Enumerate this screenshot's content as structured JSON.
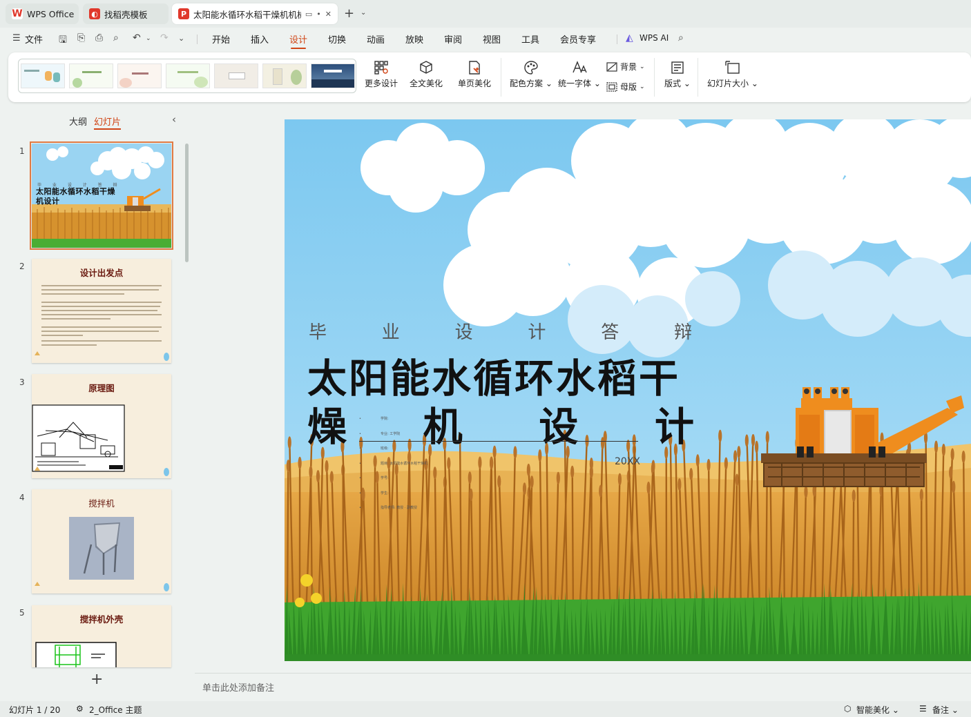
{
  "tabs": [
    {
      "label": "WPS Office",
      "icon": "wps-logo-icon"
    },
    {
      "label": "找稻壳模板",
      "icon": "docer-icon"
    },
    {
      "label": "太阳能水循环水稻干燥机机械",
      "icon": "ppt-file-icon"
    }
  ],
  "menu": {
    "file": "文件",
    "items": [
      "开始",
      "插入",
      "设计",
      "切换",
      "动画",
      "放映",
      "审阅",
      "视图",
      "工具",
      "会员专享"
    ],
    "active": "设计",
    "wps_ai": "WPS AI"
  },
  "ribbon": {
    "more_design": "更多设计",
    "full_beautify": "全文美化",
    "page_beautify": "单页美化",
    "color_scheme": "配色方案",
    "unify_font": "统一字体",
    "background": "背景",
    "master": "母版",
    "layout": "版式",
    "slide_size": "幻灯片大小"
  },
  "pane": {
    "outline_tab": "大纲",
    "slides_tab": "幻灯片",
    "add_icon": "+"
  },
  "slides": [
    {
      "num": "1",
      "title": "太阳能水循环水稻干燥机设计",
      "subtitle": "毕 业 设 计 答 辩"
    },
    {
      "num": "2",
      "title": "设计出发点"
    },
    {
      "num": "3",
      "title": "原理图"
    },
    {
      "num": "4",
      "title": "搅拌机"
    },
    {
      "num": "5",
      "title": "搅拌机外壳"
    }
  ],
  "slide_main": {
    "subtitle_chars": [
      "毕",
      "业",
      "设",
      "计",
      "答",
      "辩"
    ],
    "title_line1": "太阳能水循环水稻干",
    "title_line2_chars": [
      "燥",
      "机",
      "设",
      "计"
    ],
    "year": "20XX",
    "info_lines": [
      "学院:",
      "专业: 工学院",
      "班级:",
      "题目: 太阳能水循环水稻干燥机",
      "学号:",
      "学生:",
      "指导老师: 教授 · 副教授"
    ]
  },
  "notes_placeholder": "单击此处添加备注",
  "status": {
    "slide_counter": "幻灯片 1 / 20",
    "theme": "2_Office 主题",
    "smart_beautify": "智能美化",
    "notes": "备注"
  },
  "colors": {
    "accent": "#d04415",
    "wps_red": "#e0382b",
    "sky": "#8fd0f2",
    "wheat": "#d9952e",
    "grass": "#3fa52e",
    "harvester": "#ef8d1e"
  }
}
